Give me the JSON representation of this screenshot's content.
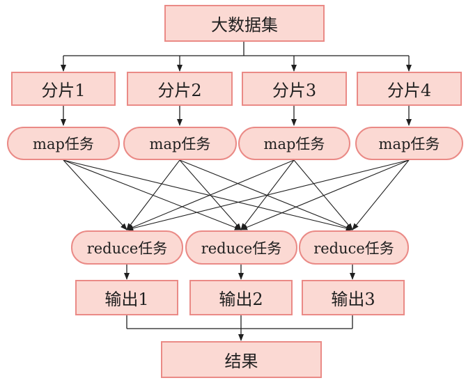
{
  "dataset": {
    "label": "大数据集"
  },
  "shards": [
    {
      "label": "分片1"
    },
    {
      "label": "分片2"
    },
    {
      "label": "分片3"
    },
    {
      "label": "分片4"
    }
  ],
  "map_tasks": [
    {
      "label": "map任务"
    },
    {
      "label": "map任务"
    },
    {
      "label": "map任务"
    },
    {
      "label": "map任务"
    }
  ],
  "reduce_tasks": [
    {
      "label": "reduce任务"
    },
    {
      "label": "reduce任务"
    },
    {
      "label": "reduce任务"
    }
  ],
  "outputs": [
    {
      "label": "输出1"
    },
    {
      "label": "输出2"
    },
    {
      "label": "输出3"
    }
  ],
  "result": {
    "label": "结果"
  },
  "colors": {
    "box_fill": "#fbd9d3",
    "box_border": "#ea8a86",
    "edge": "#1f1f1f"
  }
}
